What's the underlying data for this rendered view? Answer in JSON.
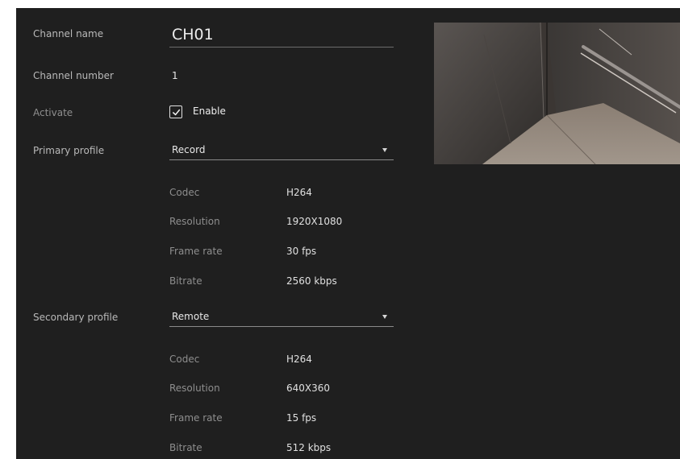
{
  "form": {
    "channel_name_label": "Channel name",
    "channel_name_value": "CH01",
    "channel_number_label": "Channel number",
    "channel_number_value": "1",
    "activate_label": "Activate",
    "activate_checked": true,
    "activate_option": "Enable",
    "primary_profile_label": "Primary profile",
    "primary_profile_value": "Record",
    "secondary_profile_label": "Secondary profile",
    "secondary_profile_value": "Remote"
  },
  "primary": {
    "codec_label": "Codec",
    "codec": "H264",
    "resolution_label": "Resolution",
    "resolution": "1920X1080",
    "frame_rate_label": "Frame rate",
    "frame_rate": "30 fps",
    "bitrate_label": "Bitrate",
    "bitrate": "2560 kbps"
  },
  "secondary": {
    "codec_label": "Codec",
    "codec": "H264",
    "resolution_label": "Resolution",
    "resolution": "640X360",
    "frame_rate_label": "Frame rate",
    "frame_rate": "15 fps",
    "bitrate_label": "Bitrate",
    "bitrate": "512 kbps"
  },
  "icons": {
    "checkbox": "checkmark-icon",
    "dropdown": "caret-down-icon"
  },
  "colors": {
    "background": "#1f1f1f",
    "label": "#b9b9b9",
    "value": "#e6e6e6"
  }
}
